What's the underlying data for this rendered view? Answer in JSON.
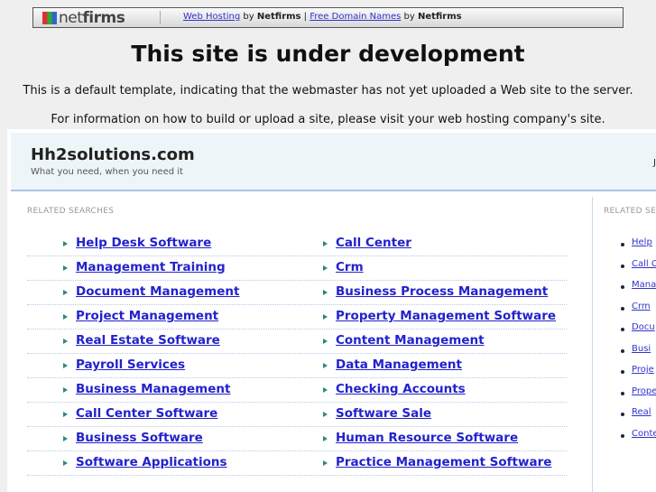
{
  "topbar": {
    "brand": "netfirms",
    "link1": "Web Hosting",
    "by1": " by ",
    "brand1": "Netfirms",
    "divider": " | ",
    "link2": "Free Domain Names",
    "by2": " by ",
    "brand2": "Netfirms"
  },
  "title": "This site is under development",
  "line1": "This is a default template, indicating that the webmaster has not yet uploaded a Web site to the server.",
  "line2": "For information on how to build or upload a site, please visit your web hosting company's site.",
  "header": {
    "site": "Hh2solutions.com",
    "tagline": "What you need, when you need it",
    "right_clipped": "Ju"
  },
  "related_label": "RELATED SEARCHES",
  "left_links": [
    [
      "Help Desk Software",
      "Call Center"
    ],
    [
      "Management Training",
      "Crm"
    ],
    [
      "Document Management",
      "Business Process Management"
    ],
    [
      "Project Management",
      "Property Management Software"
    ],
    [
      "Real Estate Software",
      "Content Management"
    ],
    [
      "Payroll Services",
      "Data Management"
    ],
    [
      "Business Management",
      "Checking Accounts"
    ],
    [
      "Call Center Software",
      "Software Sale"
    ],
    [
      "Business Software",
      "Human Resource Software"
    ],
    [
      "Software Applications",
      "Practice Management Software"
    ]
  ],
  "side_label": "RELATED SEA",
  "side_links": [
    "Help",
    "Call C",
    "Mana",
    "Crm",
    "Docu",
    "Busi",
    "Proje",
    "Prope",
    "Real",
    "Conte"
  ]
}
